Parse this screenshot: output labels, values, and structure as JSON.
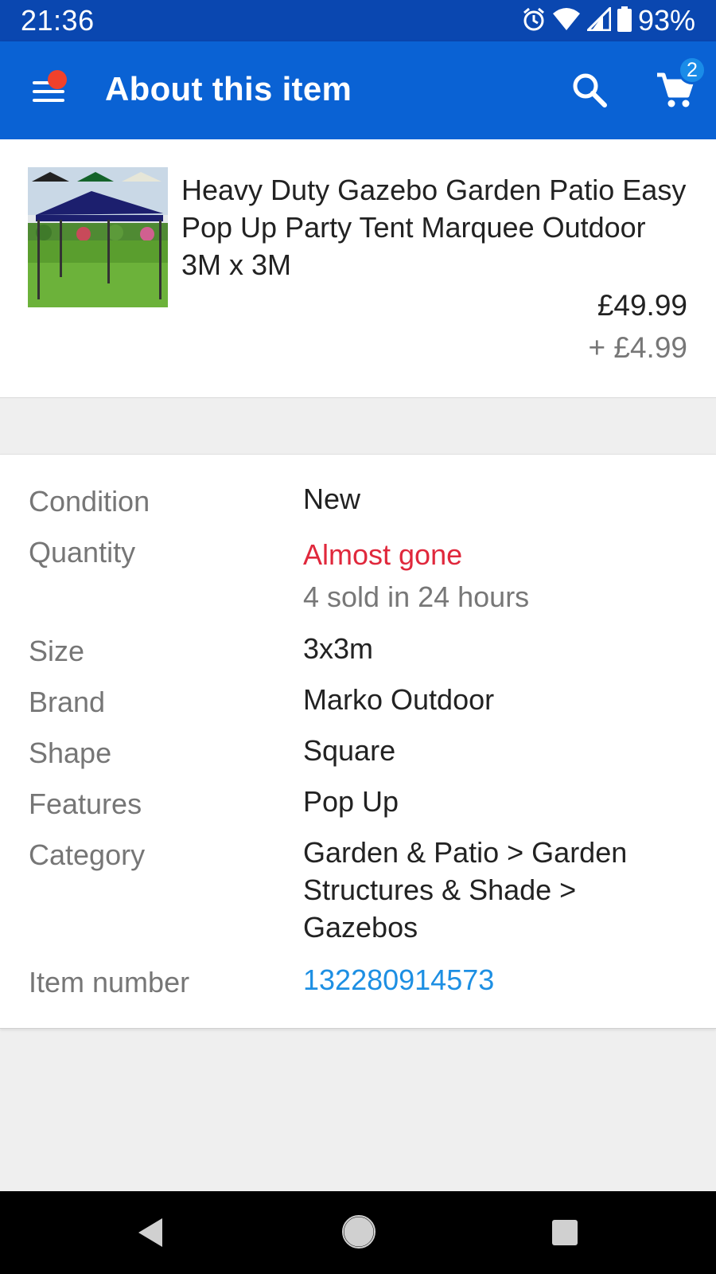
{
  "status_bar": {
    "time": "21:36",
    "battery": "93%",
    "icons": [
      "alarm-icon",
      "wifi-icon",
      "signal-icon",
      "battery-icon"
    ]
  },
  "app_bar": {
    "title": "About this item",
    "cart_count": "2",
    "icons": [
      "menu-icon",
      "search-icon",
      "cart-icon"
    ],
    "colors": {
      "app_bar": "#0a62d4",
      "status_bar": "#0a47b0",
      "notification_dot": "#f0412b",
      "badge": "#1a8ce8"
    }
  },
  "product": {
    "title": "Heavy Duty Gazebo Garden Patio Easy Pop Up Party Tent Marquee Outdoor 3M x 3M",
    "price": "£49.99",
    "shipping": "+ £4.99"
  },
  "specs": {
    "condition": {
      "label": "Condition",
      "value": "New"
    },
    "quantity": {
      "label": "Quantity",
      "value": "Almost gone",
      "sub": "4 sold in 24 hours"
    },
    "size": {
      "label": "Size",
      "value": "3x3m"
    },
    "brand": {
      "label": "Brand",
      "value": "Marko Outdoor"
    },
    "shape": {
      "label": "Shape",
      "value": "Square"
    },
    "features": {
      "label": "Features",
      "value": "Pop Up"
    },
    "category": {
      "label": "Category",
      "value": "Garden & Patio > Garden Structures & Shade > Gazebos"
    },
    "item_number": {
      "label": "Item number",
      "value": "132280914573"
    },
    "colors": {
      "almost_gone": "#e0283c",
      "link": "#1d8fe3"
    }
  },
  "nav_bar": {
    "icons": [
      "back-icon",
      "home-icon",
      "recents-icon"
    ]
  }
}
